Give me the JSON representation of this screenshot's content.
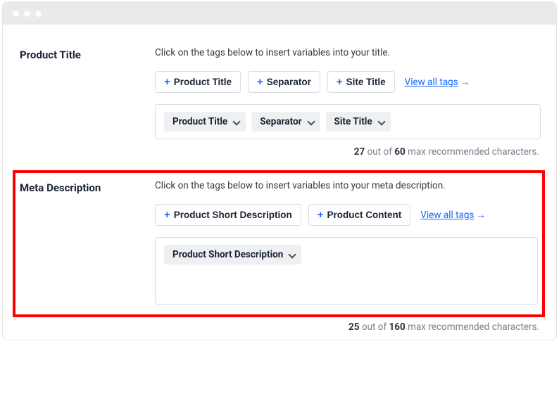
{
  "sections": {
    "title": {
      "label": "Product Title",
      "hint": "Click on the tags below to insert variables into your title.",
      "tags": [
        "Product Title",
        "Separator",
        "Site Title"
      ],
      "view_all": "View all tags",
      "chips": [
        "Product Title",
        "Separator",
        "Site Title"
      ],
      "count": "27",
      "max": "60",
      "count_prefix": "out of",
      "count_suffix": "max recommended characters."
    },
    "meta": {
      "label": "Meta Description",
      "hint": "Click on the tags below to insert variables into your meta description.",
      "tags": [
        "Product Short Description",
        "Product Content"
      ],
      "view_all": "View all tags",
      "chips": [
        "Product Short Description"
      ],
      "count": "25",
      "max": "160",
      "count_prefix": "out of",
      "count_suffix": "max recommended characters."
    }
  }
}
